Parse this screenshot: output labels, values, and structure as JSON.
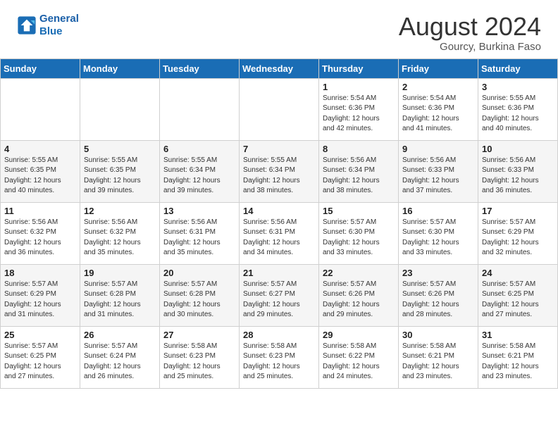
{
  "header": {
    "logo_line1": "General",
    "logo_line2": "Blue",
    "month": "August 2024",
    "location": "Gourcy, Burkina Faso"
  },
  "weekdays": [
    "Sunday",
    "Monday",
    "Tuesday",
    "Wednesday",
    "Thursday",
    "Friday",
    "Saturday"
  ],
  "weeks": [
    [
      {
        "day": "",
        "info": ""
      },
      {
        "day": "",
        "info": ""
      },
      {
        "day": "",
        "info": ""
      },
      {
        "day": "",
        "info": ""
      },
      {
        "day": "1",
        "info": "Sunrise: 5:54 AM\nSunset: 6:36 PM\nDaylight: 12 hours\nand 42 minutes."
      },
      {
        "day": "2",
        "info": "Sunrise: 5:54 AM\nSunset: 6:36 PM\nDaylight: 12 hours\nand 41 minutes."
      },
      {
        "day": "3",
        "info": "Sunrise: 5:55 AM\nSunset: 6:36 PM\nDaylight: 12 hours\nand 40 minutes."
      }
    ],
    [
      {
        "day": "4",
        "info": "Sunrise: 5:55 AM\nSunset: 6:35 PM\nDaylight: 12 hours\nand 40 minutes."
      },
      {
        "day": "5",
        "info": "Sunrise: 5:55 AM\nSunset: 6:35 PM\nDaylight: 12 hours\nand 39 minutes."
      },
      {
        "day": "6",
        "info": "Sunrise: 5:55 AM\nSunset: 6:34 PM\nDaylight: 12 hours\nand 39 minutes."
      },
      {
        "day": "7",
        "info": "Sunrise: 5:55 AM\nSunset: 6:34 PM\nDaylight: 12 hours\nand 38 minutes."
      },
      {
        "day": "8",
        "info": "Sunrise: 5:56 AM\nSunset: 6:34 PM\nDaylight: 12 hours\nand 38 minutes."
      },
      {
        "day": "9",
        "info": "Sunrise: 5:56 AM\nSunset: 6:33 PM\nDaylight: 12 hours\nand 37 minutes."
      },
      {
        "day": "10",
        "info": "Sunrise: 5:56 AM\nSunset: 6:33 PM\nDaylight: 12 hours\nand 36 minutes."
      }
    ],
    [
      {
        "day": "11",
        "info": "Sunrise: 5:56 AM\nSunset: 6:32 PM\nDaylight: 12 hours\nand 36 minutes."
      },
      {
        "day": "12",
        "info": "Sunrise: 5:56 AM\nSunset: 6:32 PM\nDaylight: 12 hours\nand 35 minutes."
      },
      {
        "day": "13",
        "info": "Sunrise: 5:56 AM\nSunset: 6:31 PM\nDaylight: 12 hours\nand 35 minutes."
      },
      {
        "day": "14",
        "info": "Sunrise: 5:56 AM\nSunset: 6:31 PM\nDaylight: 12 hours\nand 34 minutes."
      },
      {
        "day": "15",
        "info": "Sunrise: 5:57 AM\nSunset: 6:30 PM\nDaylight: 12 hours\nand 33 minutes."
      },
      {
        "day": "16",
        "info": "Sunrise: 5:57 AM\nSunset: 6:30 PM\nDaylight: 12 hours\nand 33 minutes."
      },
      {
        "day": "17",
        "info": "Sunrise: 5:57 AM\nSunset: 6:29 PM\nDaylight: 12 hours\nand 32 minutes."
      }
    ],
    [
      {
        "day": "18",
        "info": "Sunrise: 5:57 AM\nSunset: 6:29 PM\nDaylight: 12 hours\nand 31 minutes."
      },
      {
        "day": "19",
        "info": "Sunrise: 5:57 AM\nSunset: 6:28 PM\nDaylight: 12 hours\nand 31 minutes."
      },
      {
        "day": "20",
        "info": "Sunrise: 5:57 AM\nSunset: 6:28 PM\nDaylight: 12 hours\nand 30 minutes."
      },
      {
        "day": "21",
        "info": "Sunrise: 5:57 AM\nSunset: 6:27 PM\nDaylight: 12 hours\nand 29 minutes."
      },
      {
        "day": "22",
        "info": "Sunrise: 5:57 AM\nSunset: 6:26 PM\nDaylight: 12 hours\nand 29 minutes."
      },
      {
        "day": "23",
        "info": "Sunrise: 5:57 AM\nSunset: 6:26 PM\nDaylight: 12 hours\nand 28 minutes."
      },
      {
        "day": "24",
        "info": "Sunrise: 5:57 AM\nSunset: 6:25 PM\nDaylight: 12 hours\nand 27 minutes."
      }
    ],
    [
      {
        "day": "25",
        "info": "Sunrise: 5:57 AM\nSunset: 6:25 PM\nDaylight: 12 hours\nand 27 minutes."
      },
      {
        "day": "26",
        "info": "Sunrise: 5:57 AM\nSunset: 6:24 PM\nDaylight: 12 hours\nand 26 minutes."
      },
      {
        "day": "27",
        "info": "Sunrise: 5:58 AM\nSunset: 6:23 PM\nDaylight: 12 hours\nand 25 minutes."
      },
      {
        "day": "28",
        "info": "Sunrise: 5:58 AM\nSunset: 6:23 PM\nDaylight: 12 hours\nand 25 minutes."
      },
      {
        "day": "29",
        "info": "Sunrise: 5:58 AM\nSunset: 6:22 PM\nDaylight: 12 hours\nand 24 minutes."
      },
      {
        "day": "30",
        "info": "Sunrise: 5:58 AM\nSunset: 6:21 PM\nDaylight: 12 hours\nand 23 minutes."
      },
      {
        "day": "31",
        "info": "Sunrise: 5:58 AM\nSunset: 6:21 PM\nDaylight: 12 hours\nand 23 minutes."
      }
    ]
  ]
}
